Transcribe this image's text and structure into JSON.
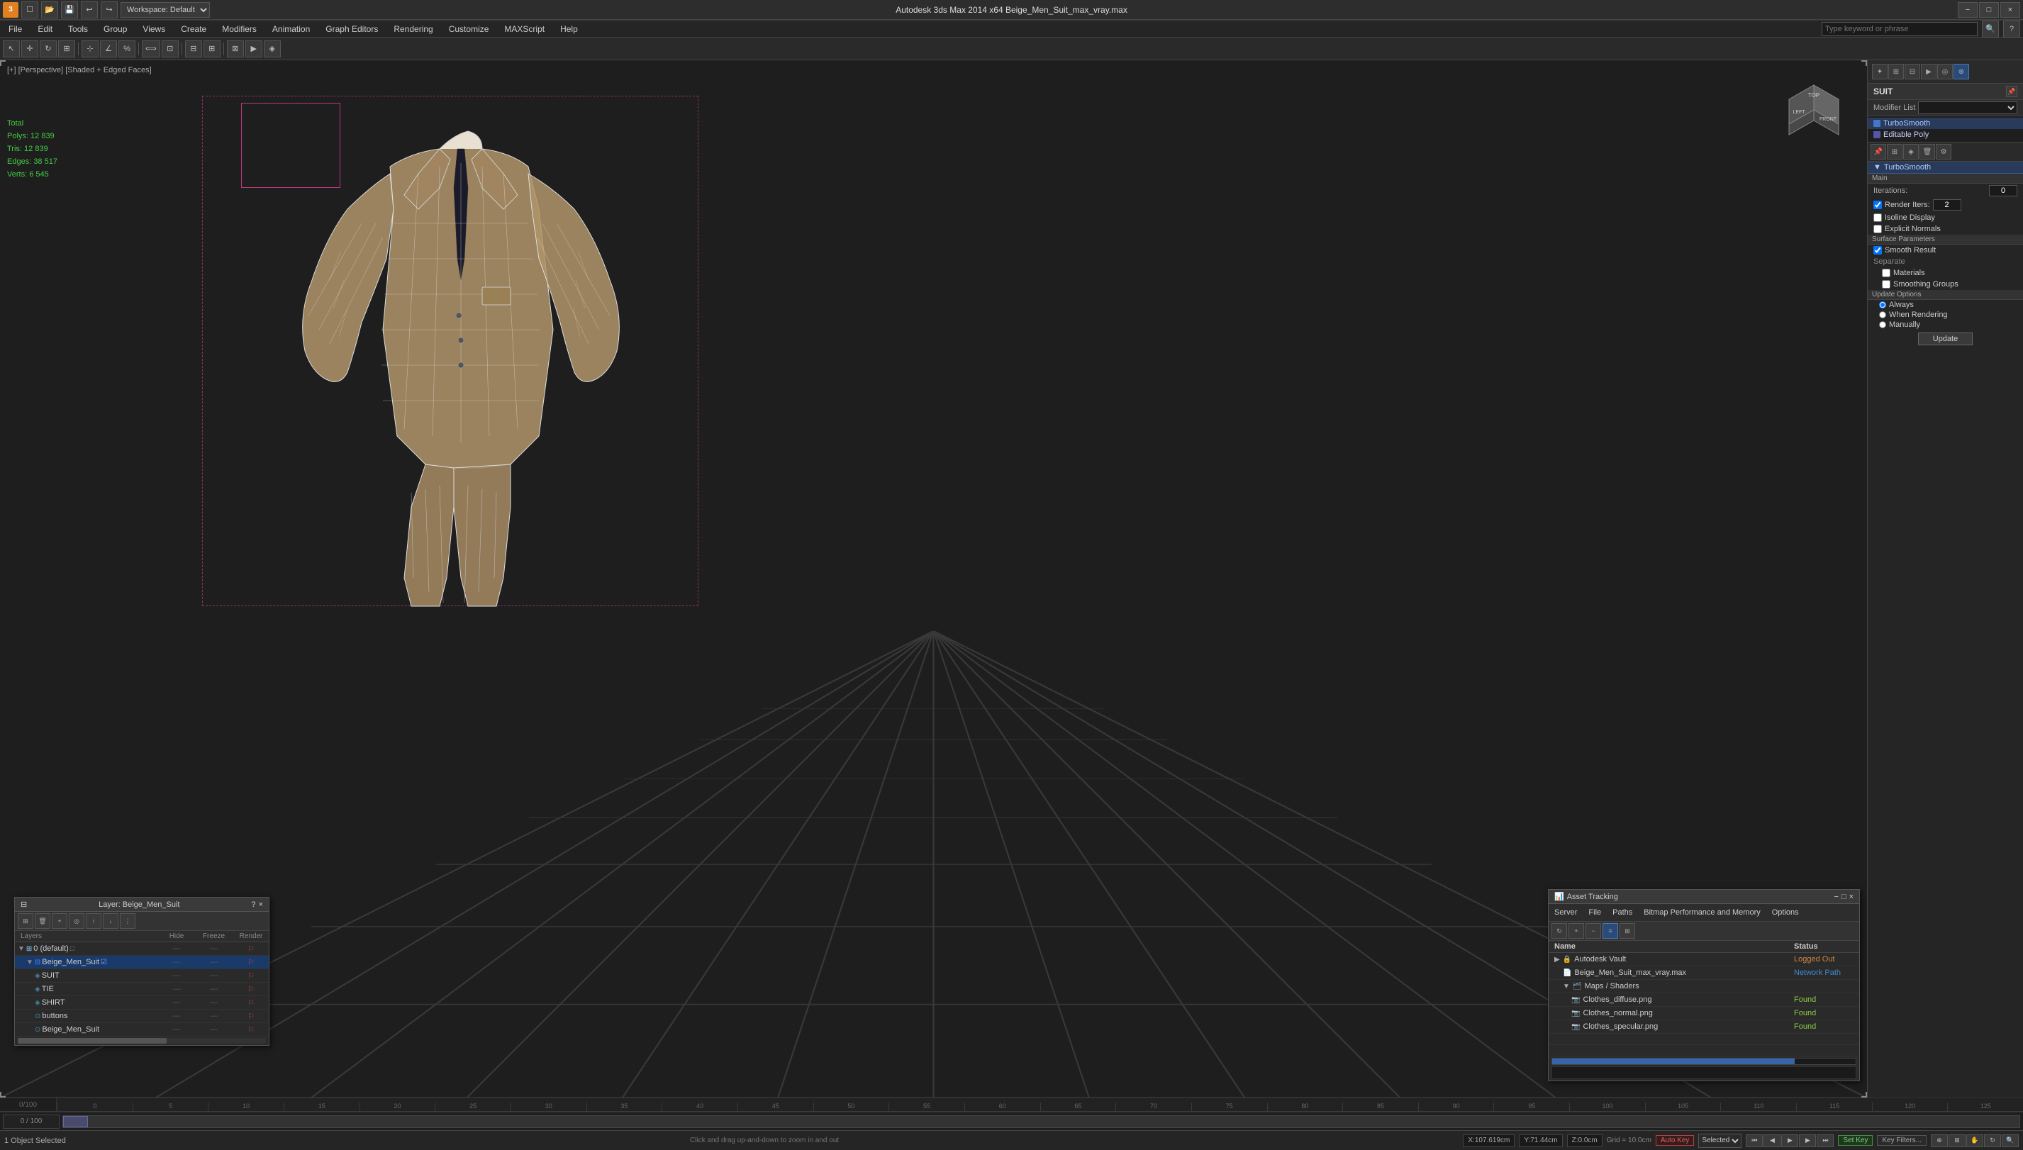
{
  "titlebar": {
    "logo": "3",
    "title": "Autodesk 3ds Max  2014 x64          Beige_Men_Suit_max_vray.max",
    "min_label": "−",
    "max_label": "□",
    "close_label": "×"
  },
  "toolbar": {
    "workspace_label": "Workspace: Default",
    "file_label": "File",
    "edit_label": "Edit",
    "tools_label": "Tools",
    "group_label": "Group",
    "views_label": "Views",
    "create_label": "Create",
    "modifiers_label": "Modifiers",
    "animation_label": "Animation",
    "graph_editors_label": "Graph Editors",
    "rendering_label": "Rendering",
    "customize_label": "Customize",
    "maxscript_label": "MAXScript",
    "help_label": "Help",
    "search_placeholder": "Type keyword or phrase"
  },
  "viewport": {
    "label": "[+] [Perspective] [Shaded + Edged Faces]",
    "stats_total": "Total",
    "stats_polys_label": "Polys:",
    "stats_polys_val": "12 839",
    "stats_tris_label": "Tris:",
    "stats_tris_val": "12 839",
    "stats_edges_label": "Edges:",
    "stats_edges_val": "38 517",
    "stats_verts_label": "Verts:",
    "stats_verts_val": "6 545"
  },
  "right_panel": {
    "object_name": "SUIT",
    "modifier_list_label": "Modifier List",
    "turbosmooth_label": "TurboSmooth",
    "editable_poly_label": "Editable Poly",
    "main_section": "Main",
    "iterations_label": "Iterations:",
    "iterations_val": "0",
    "render_iters_label": "Render Iters:",
    "render_iters_val": "2",
    "isoline_display_label": "Isoline Display",
    "explicit_normals_label": "Explicit Normals",
    "surface_params_label": "Surface Parameters",
    "smooth_result_label": "Smooth Result",
    "separate_label": "Separate",
    "materials_label": "Materials",
    "smoothing_groups_label": "Smoothing Groups",
    "update_options_label": "Update Options",
    "always_label": "Always",
    "when_rendering_label": "When Rendering",
    "manually_label": "Manually",
    "update_btn": "Update"
  },
  "layer_manager": {
    "title": "Layer: Beige_Men_Suit",
    "close_label": "×",
    "help_label": "?",
    "col_layers": "Layers",
    "col_hide": "Hide",
    "col_freeze": "Freeze",
    "col_render": "Render",
    "layers": [
      {
        "name": "0 (default)",
        "indent": 0,
        "selected": false,
        "hide": "—",
        "freeze": "—",
        "render": "—"
      },
      {
        "name": "Beige_Men_Suit",
        "indent": 1,
        "selected": true,
        "hide": "—",
        "freeze": "—",
        "render": "—"
      },
      {
        "name": "SUIT",
        "indent": 2,
        "selected": false,
        "hide": "—",
        "freeze": "—",
        "render": "—"
      },
      {
        "name": "TIE",
        "indent": 2,
        "selected": false,
        "hide": "—",
        "freeze": "—",
        "render": "—"
      },
      {
        "name": "SHIRT",
        "indent": 2,
        "selected": false,
        "hide": "—",
        "freeze": "—",
        "render": "—"
      },
      {
        "name": "buttons",
        "indent": 2,
        "selected": false,
        "hide": "—",
        "freeze": "—",
        "render": "—"
      },
      {
        "name": "Beige_Men_Suit",
        "indent": 2,
        "selected": false,
        "hide": "—",
        "freeze": "—",
        "render": "—"
      }
    ],
    "status_text": "Click and drag up-and-down to zoom in and out"
  },
  "asset_tracking": {
    "title": "Asset Tracking",
    "server_label": "Server",
    "file_label": "File",
    "paths_label": "Paths",
    "bitmap_perf_label": "Bitmap Performance and Memory",
    "options_label": "Options",
    "col_name": "Name",
    "col_status": "Status",
    "assets": [
      {
        "name": "Autodesk Vault",
        "indent": 0,
        "status": "Logged Out",
        "status_class": "status-loggedout"
      },
      {
        "name": "Beige_Men_Suit_max_vray.max",
        "indent": 1,
        "status": "Network Path",
        "status_class": "status-network"
      },
      {
        "name": "Maps / Shaders",
        "indent": 1,
        "status": "",
        "status_class": ""
      },
      {
        "name": "Clothes_diffuse.png",
        "indent": 2,
        "status": "Found",
        "status_class": "status-found"
      },
      {
        "name": "Clothes_normal.png",
        "indent": 2,
        "status": "Found",
        "status_class": "status-found"
      },
      {
        "name": "Clothes_specular.png",
        "indent": 2,
        "status": "Found",
        "status_class": "status-found"
      }
    ]
  },
  "timeline": {
    "current_frame": "0",
    "total_frames": "100",
    "ticks": [
      "0",
      "5",
      "10",
      "15",
      "20",
      "25",
      "30",
      "35",
      "40",
      "45",
      "50",
      "55",
      "60",
      "65",
      "70",
      "75",
      "80",
      "85",
      "90",
      "95",
      "100",
      "105",
      "110",
      "115",
      "120",
      "125"
    ]
  },
  "status_bar": {
    "selection_text": "1 Object Selected",
    "help_text": "Click and drag up-and-down to zoom in and out",
    "x_coord": "107.619cm",
    "y_coord": "71.44cm",
    "z_coord": "0.0cm",
    "grid_label": "Grid = 10.0cm",
    "auto_key_label": "Auto Key",
    "selected_label": "Selected",
    "set_key_label": "Set Key",
    "key_filters_label": "Key Filters..."
  }
}
